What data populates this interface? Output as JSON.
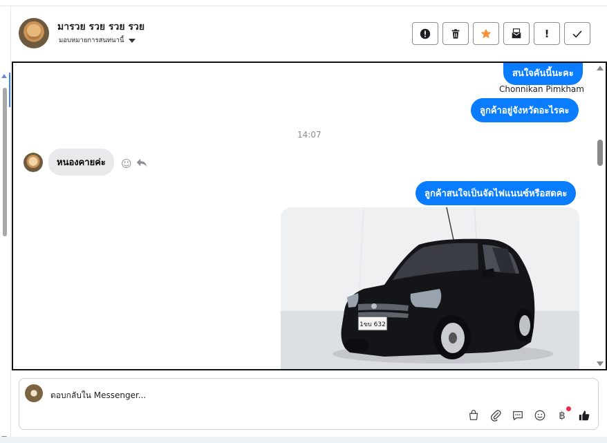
{
  "header": {
    "contact_name": "มารวย รวย รวย รวย",
    "assign_label": "มอบหมายการสนทนานี้"
  },
  "toolbar": {
    "buttons": [
      {
        "icon": "alert-circle-icon"
      },
      {
        "icon": "trash-icon"
      },
      {
        "icon": "star-icon",
        "color": "#f7923b"
      },
      {
        "icon": "mark-unread-icon"
      },
      {
        "icon": "exclamation-icon",
        "glyph": "!"
      },
      {
        "icon": "check-icon"
      }
    ]
  },
  "messages": {
    "out1": "สนใจคันนี้นะคะ",
    "sender": "Chonnikan Pimkham",
    "out2": "ลูกค้าอยู่จังหวัดอะไรคะ",
    "time": "14:07",
    "in1": "หนองคายค่ะ",
    "out3": "ลูกค้าสนใจเป็นจัดไฟแนนซ์หรือสดคะ",
    "plate": "1ขบ 632"
  },
  "composer": {
    "placeholder": "ตอบกลับใน Messenger..."
  },
  "colors": {
    "outgoing_bubble": "#0a7cff",
    "incoming_bubble": "#e9e9eb",
    "notification_dot": "#f02849"
  }
}
